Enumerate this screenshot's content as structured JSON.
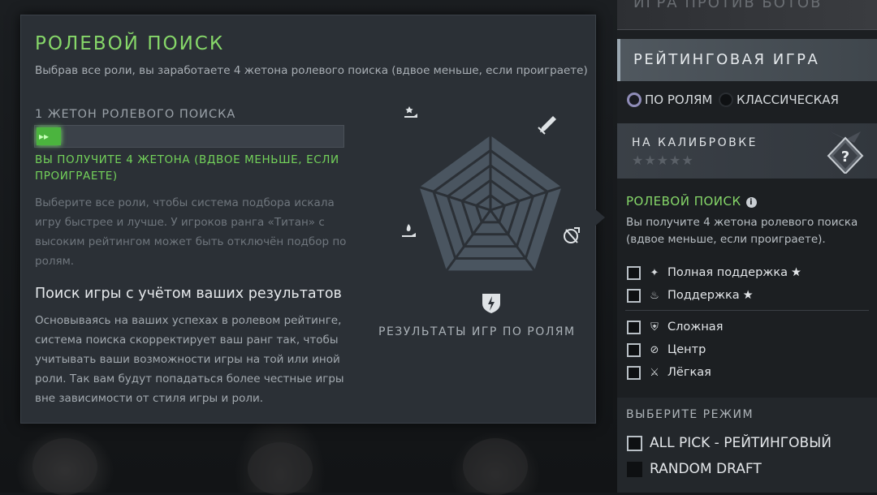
{
  "tooltip": {
    "title": "РОЛЕВОЙ ПОИСК",
    "subtitle": "Выбрав все роли, вы заработаете 4 жетона ролевого поиска (вдвое меньше, если проиграете)",
    "token_label": "1 ЖЕТОН РОЛЕВОГО ПОИСКА",
    "progress_fraction": 0.08,
    "progress_glyph": "▸▸",
    "gain_text": "ВЫ ПОЛУЧИТЕ 4 ЖЕТОНА (ВДВОЕ МЕНЬШЕ, ЕСЛИ ПРОИГРАЕТЕ)",
    "hint": "Выберите все роли, чтобы система подбора искала игру быстрее и лучше. У игроков ранга «Титан» с высоким рейтингом может быть отключён подбор по ролям.",
    "heading": "Поиск игры с учётом ваших результатов",
    "body": "Основываясь на ваших успехах в ролевом рейтинге, система поиска скорректирует ваш ранг так, чтобы учитывать ваши возможности игры на той или иной роли. Так вам будут попадаться более честные игры вне зависимости от стиля игры и роли.",
    "radar_caption": "РЕЗУЛЬТАТЫ ИГР ПО РОЛЯМ",
    "radar_icons": [
      "hard-support-icon",
      "carry-icon",
      "mid-icon",
      "offlane-icon",
      "support-icon"
    ]
  },
  "sidebar": {
    "bots_label": "ИГРА ПРОТИВ БОТОВ",
    "ranked_label": "РЕЙТИНГОВАЯ ИГРА",
    "mode_by_roles": "ПО РОЛЯМ",
    "mode_classic": "КЛАССИЧЕСКАЯ",
    "selected_mode": "ПО РОЛЯМ",
    "calibration_label": "НА КАЛИБРОВКЕ",
    "calibration_stars": "★★★★★",
    "badge_symbol": "?",
    "role_search_title": "РОЛЕВОЙ ПОИСК",
    "info_symbol": "i",
    "role_search_desc": "Вы получите 4 жетона ролевого поиска (вдвое меньше, если проиграете).",
    "roles": [
      {
        "label": "Полная поддержка",
        "star": "★",
        "checked": true
      },
      {
        "label": "Поддержка",
        "star": "★",
        "checked": true
      },
      {
        "label": "Сложная",
        "star": "",
        "checked": true
      },
      {
        "label": "Центр",
        "star": "",
        "checked": true
      },
      {
        "label": "Лёгкая",
        "star": "",
        "checked": true
      }
    ],
    "pick_title": "ВЫБЕРИТЕ РЕЖИМ",
    "pick_modes": [
      {
        "label": "ALL PICK - РЕЙТИНГОВЫЙ",
        "checked": true
      },
      {
        "label": "RANDOM DRAFT",
        "checked": false
      }
    ]
  },
  "colors": {
    "accent_green": "#86d769",
    "progress": "#4bb43e",
    "panel": "#2b3036"
  }
}
